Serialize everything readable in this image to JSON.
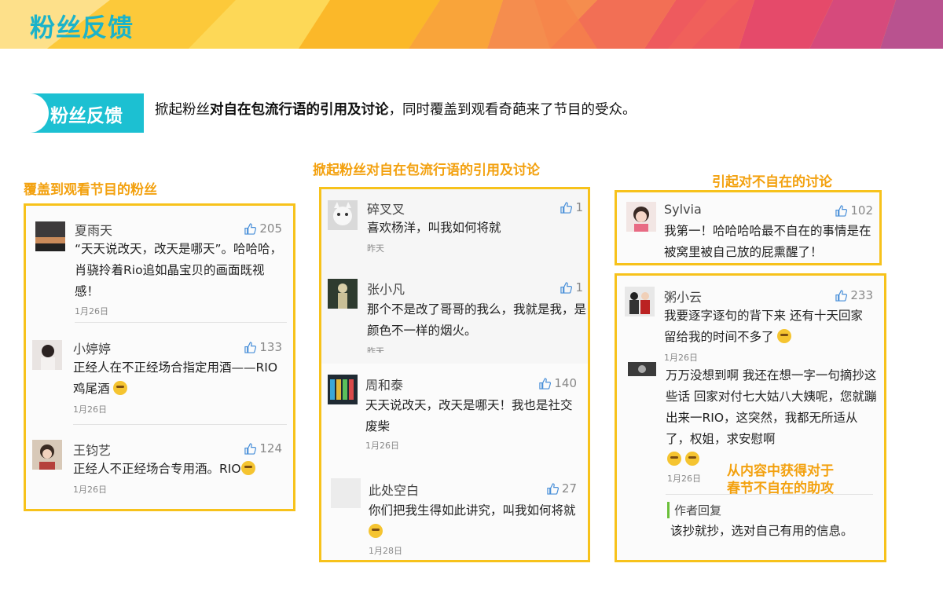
{
  "header": {
    "title": "粉丝反馈"
  },
  "section": {
    "tag": "粉丝反馈",
    "intro_prefix": "掀起粉丝",
    "intro_bold": "对自在包流行语的引用及讨论",
    "intro_suffix": "，同时覆盖到观看奇葩来了节目的受众。"
  },
  "columns": {
    "left_heading": "覆盖到观看节目的粉丝",
    "middle_heading": "掀起粉丝对自在包流行语的引用及讨论",
    "right_heading": "引起对不自在的讨论"
  },
  "left_comments": [
    {
      "name": "夏雨天",
      "likes": "205",
      "text": "“天天说改天，改天是哪天”。哈哈哈，肖骁拎着Rio追如晶宝贝的画面既视感！",
      "date": "1月26日"
    },
    {
      "name": "小婷婷",
      "likes": "133",
      "text": "正经人在不正经场合指定用酒——RIO鸡尾酒",
      "date": "1月26日"
    },
    {
      "name": "王钧艺",
      "likes": "124",
      "text": "正经人不正经场合专用酒。RIO",
      "date": "1月26日"
    }
  ],
  "middle_comments": [
    {
      "name": "碎叉叉",
      "likes": "1",
      "text": "喜欢杨洋，叫我如何将就",
      "date": "昨天"
    },
    {
      "name": "张小凡",
      "likes": "1",
      "text": "那个不是改了哥哥的我么，我就是我，是颜色不一样的烟火。",
      "date": "昨天"
    },
    {
      "name": "周和泰",
      "likes": "140",
      "text": "天天说改天，改天是哪天！我也是社交废柴",
      "date": "1月26日"
    },
    {
      "name": "此处空白",
      "likes": "27",
      "text": "你们把我生得如此讲究，叫我如何将就",
      "date": "1月28日"
    }
  ],
  "right_top_comment": {
    "name": "Sylvia",
    "likes": "102",
    "text": "我第一！哈哈哈哈最不自在的事情是在被窝里被自己放的屁熏醒了！"
  },
  "right_bottom": {
    "comment": {
      "name": "粥小云",
      "likes": "233",
      "text": "我要逐字逐句的背下来  还有十天回家  留给我的时间不多了",
      "date": "1月26日"
    },
    "reply": {
      "text": "万万没想到啊  我还在想一字一句摘抄这些话 回家对付七大姑八大姨呢，您就蹦出来一RIO，这突然，我都无所适从了，权姐，求安慰啊",
      "date": "1月26日"
    },
    "highlight_line1": "从内容中获得对于",
    "highlight_line2": "春节不自在的助攻",
    "author_reply_label": "作者回复",
    "author_reply_text": "该抄就抄，选对自己有用的信息。"
  },
  "colors": {
    "accent_teal": "#1cc0d2",
    "border_yellow": "#f7c21b",
    "heading_orange": "#f3a10f"
  }
}
